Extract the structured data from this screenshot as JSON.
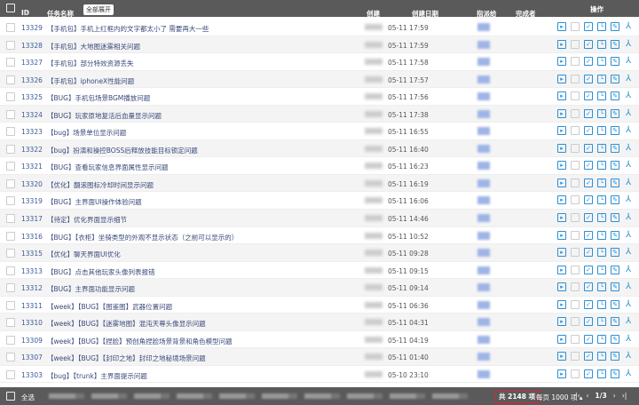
{
  "header": {
    "id": "ID",
    "name": "任务名称",
    "expand_all": "全部展开",
    "creator": "创建",
    "created_date": "创建日期",
    "assignee": "指派给",
    "finisher": "完成者",
    "actions": "操作"
  },
  "rows": [
    {
      "id": "13329",
      "name": "【手机包】手机上红框内的文字都太小了 需要再大一些",
      "date": "05-11 17:59"
    },
    {
      "id": "13328",
      "name": "【手机包】大地图迷雾相关问题",
      "date": "05-11 17:59"
    },
    {
      "id": "13327",
      "name": "【手机包】部分特效资源丢失",
      "date": "05-11 17:58"
    },
    {
      "id": "13326",
      "name": "【手机包】iphoneX性能问题",
      "date": "05-11 17:57"
    },
    {
      "id": "13325",
      "name": "【BUG】手机包场景BGM播放问题",
      "date": "05-11 17:56"
    },
    {
      "id": "13324",
      "name": "【BUG】玩家原地复活后血量显示问题",
      "date": "05-11 17:38"
    },
    {
      "id": "13323",
      "name": "【bug】场景单位显示问题",
      "date": "05-11 16:55"
    },
    {
      "id": "13322",
      "name": "【bug】扮演和操控BOSS后释放技能目标锁定问题",
      "date": "05-11 16:40"
    },
    {
      "id": "13321",
      "name": "【BUG】查看玩家信息界面属性显示问题",
      "date": "05-11 16:23"
    },
    {
      "id": "13320",
      "name": "【优化】翻滚图标冷却时间显示问题",
      "date": "05-11 16:19"
    },
    {
      "id": "13319",
      "name": "【BUG】主界面UI操作体验问题",
      "date": "05-11 16:06"
    },
    {
      "id": "13317",
      "name": "【待定】优化界面显示细节",
      "date": "05-11 14:46"
    },
    {
      "id": "13316",
      "name": "【BUG】【衣柜】坐骑类型的外观不显示状态（之前可以显示的）",
      "date": "05-11 10:52"
    },
    {
      "id": "13315",
      "name": "【优化】聊天界面UI优化",
      "date": "05-11 09:28"
    },
    {
      "id": "13313",
      "name": "【BUG】点击其他玩家头像列表报错",
      "date": "05-11 09:15"
    },
    {
      "id": "13312",
      "name": "【BUG】主界面功能显示问题",
      "date": "05-11 09:14"
    },
    {
      "id": "13311",
      "name": "【week】【BUG】【图鉴图】武器位置问题",
      "date": "05-11 06:36"
    },
    {
      "id": "13310",
      "name": "【week】【BUG】【迷雾地图】混沌天尊头像显示问题",
      "date": "05-11 04:31"
    },
    {
      "id": "13309",
      "name": "【week】【BUG】【捏脸】预创角捏脸场景背景和角色模型问题",
      "date": "05-11 04:19"
    },
    {
      "id": "13307",
      "name": "【week】【BUG】【封印之地】封印之地秘境场景问题",
      "date": "05-11 01:40"
    },
    {
      "id": "13303",
      "name": "【bug】【trunk】主界面提示问题",
      "date": "05-10 23:10"
    }
  ],
  "actions": [
    "play-icon",
    "pause-icon",
    "check-icon",
    "clock-icon",
    "edit-icon",
    "tree-icon"
  ],
  "footer": {
    "select_all": "全选",
    "total": "共 2148 项",
    "per_page": "每页 1000 项 ▴",
    "first": "|‹",
    "prev": "‹",
    "page": "1/3",
    "next": "›",
    "last": "›|"
  },
  "colors": {
    "header_bg": "#5a5a5a",
    "link": "#3b5998",
    "icon": "#2b8fd6",
    "highlight": "#dd2233"
  }
}
